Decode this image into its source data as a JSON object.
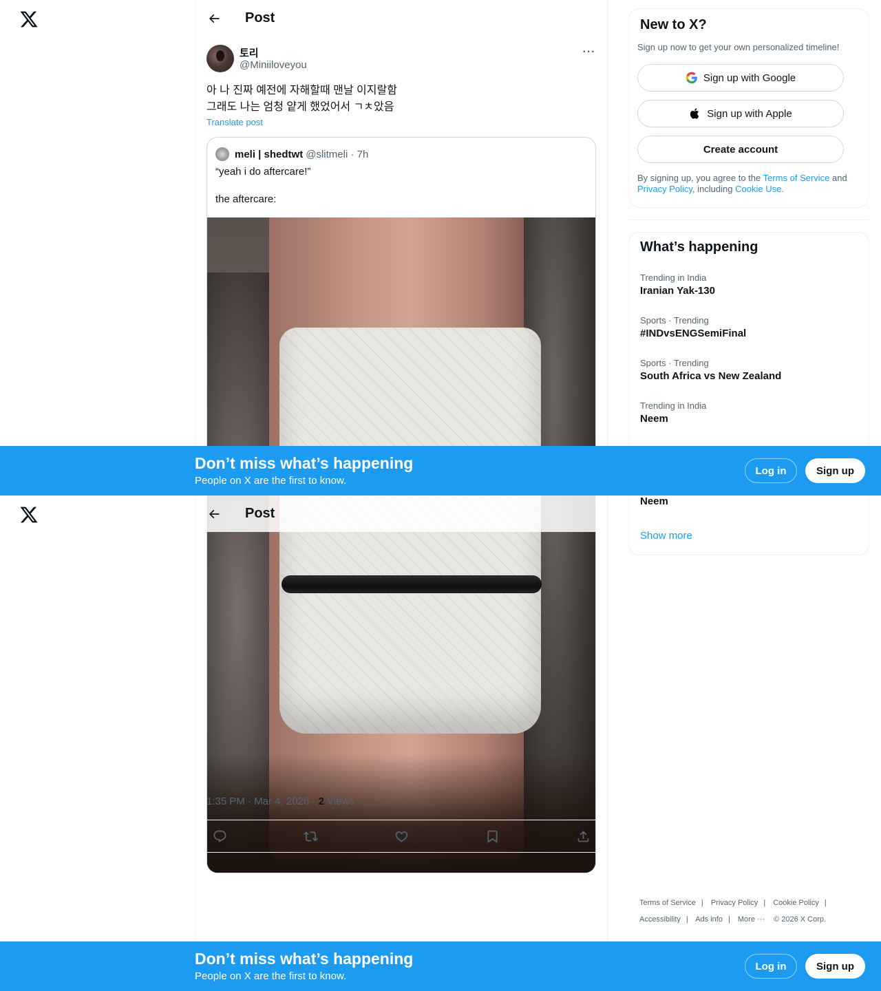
{
  "nav": {
    "logo_icon": "x-logo-icon"
  },
  "header": {
    "title": "Post"
  },
  "post": {
    "author_name": "토리",
    "author_handle": "@Miniiloveyou",
    "text_line1": "아 나 진짜 예전에 자해할때 맨날 이지랄함",
    "text_line2": "그래도 나는 엄청 얕게 했었어서 ㄱㅊ았음",
    "translate_label": "Translate post",
    "timestamp": "1:35 PM · Mar 4, 2026 · ",
    "views_count": "2",
    "views_label": " Views"
  },
  "quote": {
    "name": "meli | shedtwt",
    "handle": "@slitmeli · 7h",
    "line1": "“yeah i do aftercare!”",
    "line2": "the aftercare:"
  },
  "signup": {
    "title": "New to X?",
    "subtitle": "Sign up now to get your own personalized timeline!",
    "google_label": "Sign up with Google",
    "apple_label": "Sign up with Apple",
    "create_label": "Create account",
    "legal_prefix": "By signing up, you agree to the ",
    "legal_tos": "Terms of Service",
    "legal_and": " and ",
    "legal_privacy": "Privacy Policy",
    "legal_including": ", including ",
    "legal_cookie": "Cookie Use."
  },
  "trends": {
    "title": "What’s happening",
    "items": [
      {
        "category": "Trending in India",
        "name": "Iranian Yak-130"
      },
      {
        "category": "Sports · Trending",
        "name": "#INDvsENGSemiFinal"
      },
      {
        "category": "Sports · Trending",
        "name": "South Africa vs New Zealand"
      },
      {
        "category": "Trending in India",
        "name": "Neem"
      }
    ],
    "show_more": "Show more"
  },
  "footer": {
    "tos": "Terms of Service",
    "privacy": "Privacy Policy",
    "cookie": "Cookie Policy",
    "accessibility": "Accessibility",
    "ads": "Ads info",
    "more": "More ···",
    "copyright": "© 2026 X Corp."
  },
  "banner": {
    "title": "Don’t miss what’s happening",
    "subtitle": "People on X are the first to know.",
    "login": "Log in",
    "signup": "Sign up"
  },
  "colors": {
    "accent": "#1d9bf0",
    "text": "#0f1419",
    "muted": "#536471",
    "border": "#eff3f4"
  }
}
